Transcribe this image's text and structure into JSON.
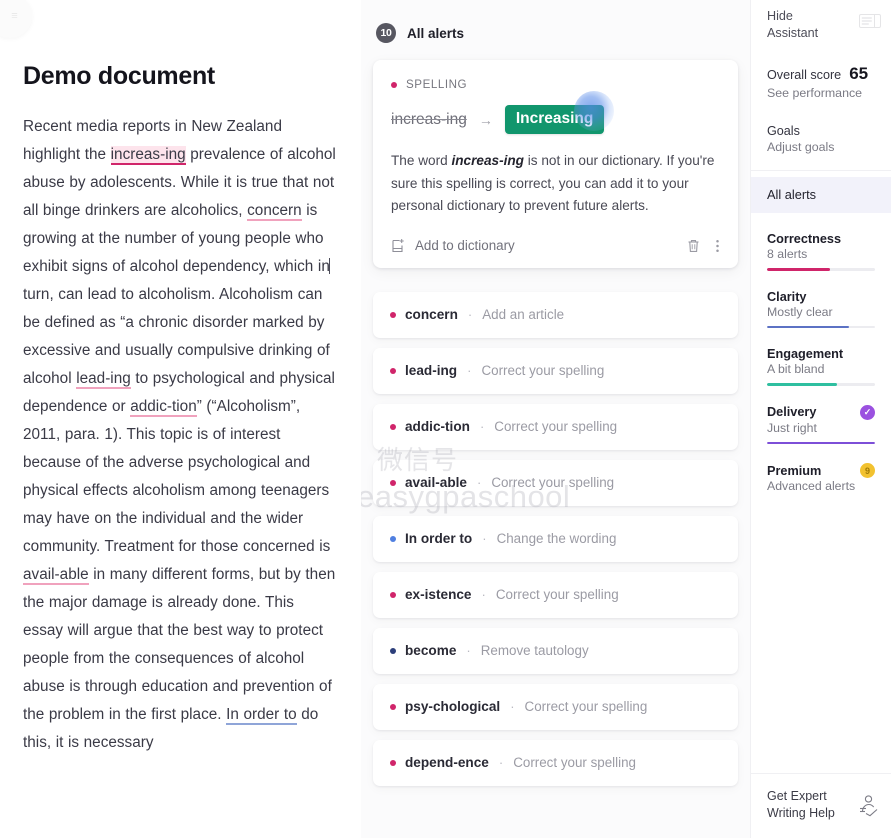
{
  "document": {
    "logo_glyph": "≡",
    "title": "Demo document",
    "paragraph_segments": [
      {
        "text": "Recent media reports in New Zealand highlight the ",
        "mark": "none"
      },
      {
        "text": "increas-ing",
        "mark": "spelling-active"
      },
      {
        "text": " prevalence of alcohol abuse by adolescents. While it is true that not all binge drinkers are alcoholics, ",
        "mark": "none"
      },
      {
        "text": "concern",
        "mark": "correctness"
      },
      {
        "text": " is growing at the number of young people who exhibit signs of alcohol dependency, which in",
        "mark": "none"
      },
      {
        "text": "",
        "mark": "caret"
      },
      {
        "text": "turn, can lead to alcoholism. Alcoholism can be defined as “a chronic disorder marked by excessive and usually compulsive drinking of alcohol ",
        "mark": "none"
      },
      {
        "text": "lead-ing",
        "mark": "spelling"
      },
      {
        "text": " to psychological and physical dependence or ",
        "mark": "none"
      },
      {
        "text": "addic-tion",
        "mark": "spelling"
      },
      {
        "text": "” (“Alcoholism”, 2011, para. 1). This topic is of interest because of the adverse psychological and physical effects alcoholism among teenagers may have on the individual and the wider community. Treatment for those concerned is ",
        "mark": "none"
      },
      {
        "text": "avail-able",
        "mark": "spelling"
      },
      {
        "text": " in many different forms, but by then the major damage is already done. This essay will argue that the best way to protect people from the consequences of alcohol abuse is through education and prevention of the problem in the first place. ",
        "mark": "none"
      },
      {
        "text": "In order to",
        "mark": "clarity"
      },
      {
        "text": " do this, it is necessary",
        "mark": "none"
      }
    ]
  },
  "alerts": {
    "header": {
      "count": "10",
      "label": "All alerts"
    },
    "expanded_card": {
      "category": "SPELLING",
      "category_kind": "correctness",
      "original": "increas-ing",
      "arrow": "→",
      "replacement": "Increasing",
      "description_prefix": "The word ",
      "description_word": "increas-ing",
      "description_suffix": " is not in our dictionary. If you're sure this spelling is correct, you can add it to your personal dictionary to prevent future alerts.",
      "add_to_dictionary": "Add to dictionary",
      "delete_icon": "trash-icon",
      "more_icon": "more-vertical-icon"
    },
    "items": [
      {
        "word": "concern",
        "separator": "·",
        "action": "Add an article",
        "kind": "correctness"
      },
      {
        "word": "lead-ing",
        "separator": "·",
        "action": "Correct your spelling",
        "kind": "correctness"
      },
      {
        "word": "addic-tion",
        "separator": "·",
        "action": "Correct your spelling",
        "kind": "correctness"
      },
      {
        "word": "avail-able",
        "separator": "·",
        "action": "Correct your spelling",
        "kind": "correctness"
      },
      {
        "word": "In order to",
        "separator": "·",
        "action": "Change the wording",
        "kind": "clarity"
      },
      {
        "word": "ex-istence",
        "separator": "·",
        "action": "Correct your spelling",
        "kind": "correctness"
      },
      {
        "word": "become",
        "separator": "·",
        "action": "Remove tautology",
        "kind": "engagement"
      },
      {
        "word": "psy-chological",
        "separator": "·",
        "action": "Correct your spelling",
        "kind": "correctness"
      },
      {
        "word": "depend-ence",
        "separator": "·",
        "action": "Correct your spelling",
        "kind": "correctness"
      }
    ],
    "watermark": {
      "line1": "微信号",
      "line2": "easygpaschool"
    }
  },
  "sidebar": {
    "hide_assistant": "Hide Assistant",
    "panel_icon": "panel-toggle-icon",
    "overall_score_label": "Overall score",
    "overall_score_value": "65",
    "see_performance": "See performance",
    "goals_label": "Goals",
    "adjust_goals": "Adjust goals",
    "all_alerts": "All alerts",
    "metrics": [
      {
        "name": "Correctness",
        "status": "8 alerts",
        "fill_pct": 58,
        "color": "#d0256a",
        "badge": null
      },
      {
        "name": "Clarity",
        "status": "Mostly clear",
        "fill_pct": 76,
        "color": "#5c72c4",
        "badge": null
      },
      {
        "name": "Engagement",
        "status": "A bit bland",
        "fill_pct": 65,
        "color": "#2fbfa0",
        "badge": null
      },
      {
        "name": "Delivery",
        "status": "Just right",
        "fill_pct": 100,
        "color": "#7d4fd8",
        "badge": {
          "type": "check",
          "text": "✓"
        }
      },
      {
        "name": "Premium",
        "status": "Advanced alerts",
        "fill_pct": 0,
        "color": "#f2c230",
        "badge": {
          "type": "premium",
          "text": "9"
        }
      }
    ],
    "expert_label": "Get Expert Writing Help",
    "expert_icon": "expert-person-icon"
  }
}
